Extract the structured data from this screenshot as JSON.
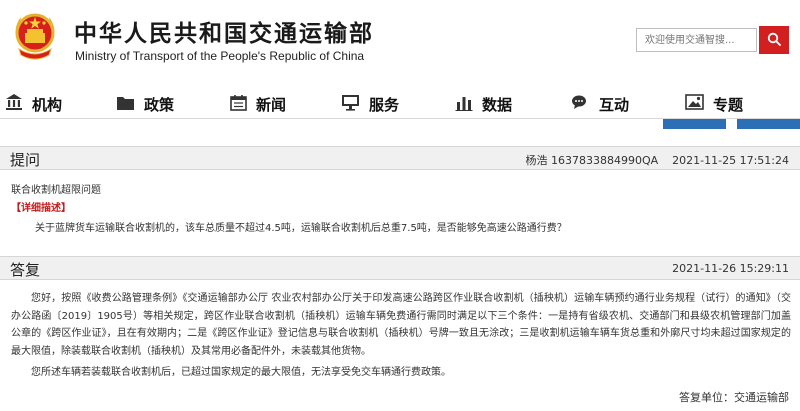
{
  "header": {
    "title_cn": "中华人民共和国交通运输部",
    "title_en": "Ministry of Transport of the People's Republic of China",
    "search_placeholder": "欢迎使用交通智搜...",
    "brand_red": "#d21f1f"
  },
  "nav": {
    "items": [
      {
        "label": "机构",
        "icon": "building-icon"
      },
      {
        "label": "政策",
        "icon": "folder-icon"
      },
      {
        "label": "新闻",
        "icon": "calendar-icon"
      },
      {
        "label": "服务",
        "icon": "monitor-icon"
      },
      {
        "label": "数据",
        "icon": "bar-chart-icon"
      },
      {
        "label": "互动",
        "icon": "chat-icon"
      },
      {
        "label": "专题",
        "icon": "image-icon"
      }
    ],
    "accent": "#2c6fb7"
  },
  "question": {
    "section_label": "提问",
    "asker": "杨浩 1637833884990QA",
    "datetime": "2021-11-25 17:51:24",
    "title": "联合收割机超限问题",
    "detail_label": "【详细描述】",
    "detail": "关于蓝牌货车运输联合收割机的，该车总质量不超过4.5吨，运输联合收割机后总重7.5吨，是否能够免高速公路通行费？"
  },
  "answer": {
    "section_label": "答复",
    "datetime": "2021-11-26 15:29:11",
    "paragraphs": [
      "您好，按照《收费公路管理条例》《交通运输部办公厅 农业农村部办公厅关于印发高速公路跨区作业联合收割机（插秧机）运输车辆预约通行业务规程（试行）的通知》（交办公路函〔2019〕1905号）等相关规定，跨区作业联合收割机（插秧机）运输车辆免费通行需同时满足以下三个条件：一是持有省级农机、交通部门和县级农机管理部门加盖公章的《跨区作业证》，且在有效期内；二是《跨区作业证》登记信息与联合收割机（插秧机）号牌一致且无涂改；三是收割机运输车辆车货总重和外廓尺寸均未超过国家规定的最大限值，除装载联合收割机（插秧机）及其常用必备配件外，未装载其他货物。",
      "您所述车辆若装载联合收割机后，已超过国家规定的最大限值，无法享受免交车辆通行费政策。"
    ],
    "signature": "答复单位：交通运输部"
  }
}
